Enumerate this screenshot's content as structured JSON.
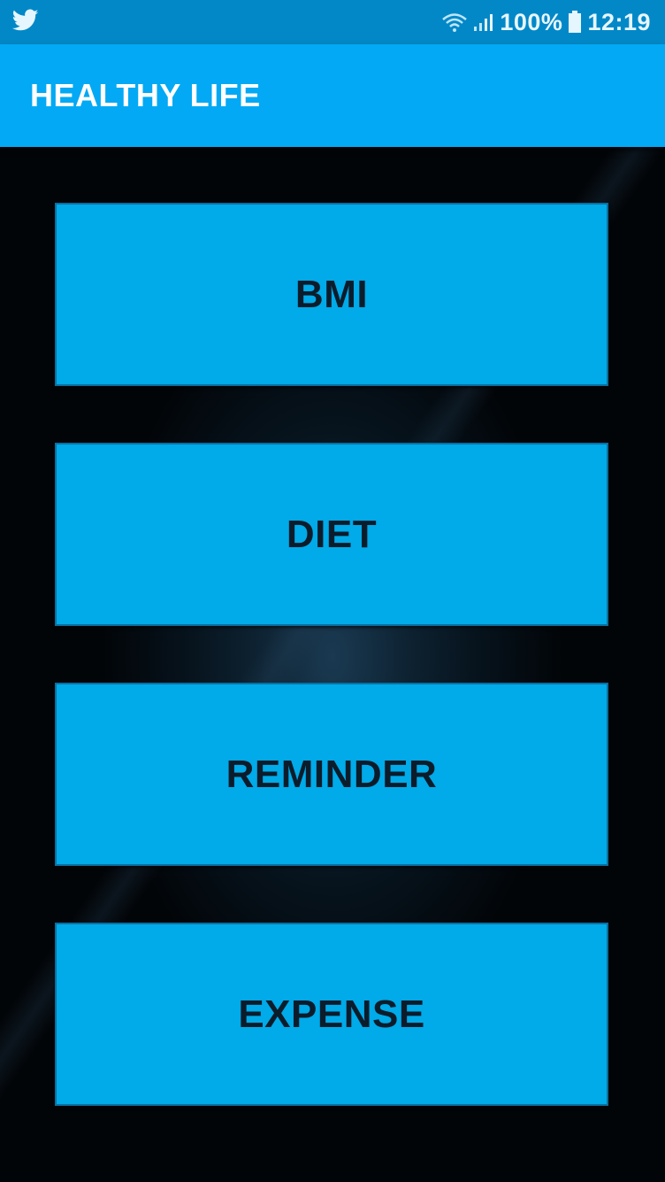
{
  "status_bar": {
    "notification_icon": "twitter-icon",
    "wifi_icon": "wifi-icon",
    "signal_icon": "signal-icon",
    "battery_text": "100%",
    "battery_icon": "battery-icon",
    "time": "12:19"
  },
  "app_bar": {
    "title": "HEALTHY LIFE"
  },
  "menu": {
    "buttons": [
      {
        "label": "BMI"
      },
      {
        "label": "DIET"
      },
      {
        "label": "REMINDER"
      },
      {
        "label": "EXPENSE"
      }
    ]
  },
  "colors": {
    "status_bar": "#0288c7",
    "app_bar": "#03a9f4",
    "button": "#01aae8",
    "button_text": "#0b1c2b"
  }
}
